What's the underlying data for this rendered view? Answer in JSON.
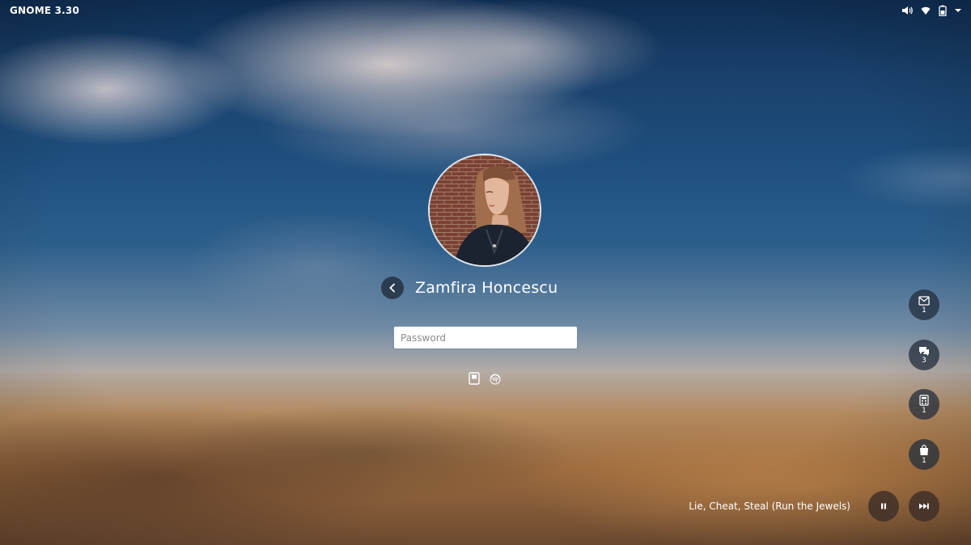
{
  "topbar": {
    "title": "GNOME 3.30",
    "status_icons": [
      "volume-icon",
      "wifi-icon",
      "battery-icon",
      "system-menu-chevron-icon"
    ]
  },
  "login": {
    "avatar": "user-avatar-photo",
    "back_icon": "chevron-left-icon",
    "username": "Zamfira Honcescu",
    "password_placeholder": "Password",
    "password_value": "",
    "auth_methods": [
      "smartcard-icon",
      "fingerprint-icon"
    ]
  },
  "notifications": [
    {
      "icon": "mail-icon",
      "count": "1"
    },
    {
      "icon": "chat-icon",
      "count": "3"
    },
    {
      "icon": "calculator-icon",
      "count": "1"
    },
    {
      "icon": "store-bag-icon",
      "count": "1"
    }
  ],
  "media": {
    "track": "Lie, Cheat, Steal (Run the Jewels)",
    "pause_icon": "pause-icon",
    "next_icon": "skip-forward-icon"
  },
  "colors": {
    "overlay_button": "#2b3646",
    "text": "#ffffff"
  }
}
